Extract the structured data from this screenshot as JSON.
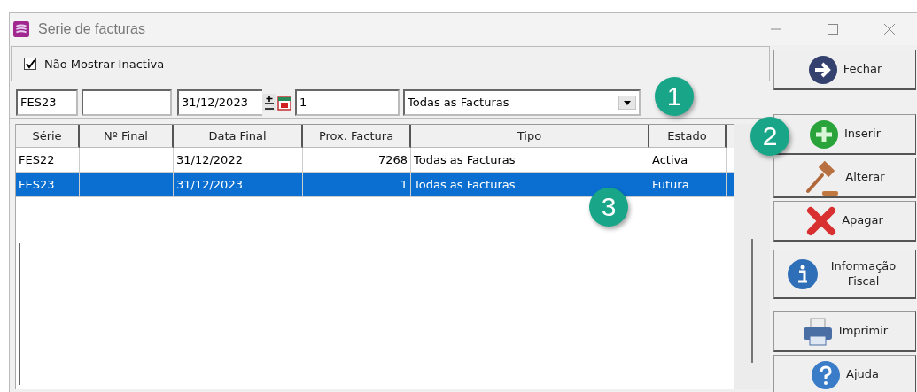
{
  "window": {
    "title": "Serie de facturas"
  },
  "filter_option": {
    "label": "Não Mostrar Inactiva",
    "checked": true
  },
  "filter_row": {
    "serie": "FES23",
    "data_final": "31/12/2023",
    "prox_factura": "1",
    "tipo": "Todas as Facturas"
  },
  "table": {
    "columns": [
      "Série",
      "Nº Final",
      "Data Final",
      "Prox. Factura",
      "Tipo",
      "Estado"
    ],
    "rows": [
      {
        "cells": [
          "FES22",
          "",
          "31/12/2022",
          "7268",
          "Todas as Facturas",
          "Activa"
        ],
        "selected": false
      },
      {
        "cells": [
          "FES23",
          "",
          "31/12/2023",
          "1",
          "Todas as Facturas",
          "Futura"
        ],
        "selected": true
      }
    ]
  },
  "buttons": [
    {
      "kind": "close",
      "label": "Fechar"
    },
    {
      "kind": "insert",
      "label": "Inserir"
    },
    {
      "kind": "edit",
      "label": "Alterar"
    },
    {
      "kind": "delete",
      "label": "Apagar"
    },
    {
      "kind": "info",
      "label": "Informação Fiscal"
    },
    {
      "kind": "print",
      "label": "Imprimir"
    },
    {
      "kind": "help",
      "label": "Ajuda"
    }
  ],
  "callouts": [
    "1",
    "2",
    "3"
  ]
}
